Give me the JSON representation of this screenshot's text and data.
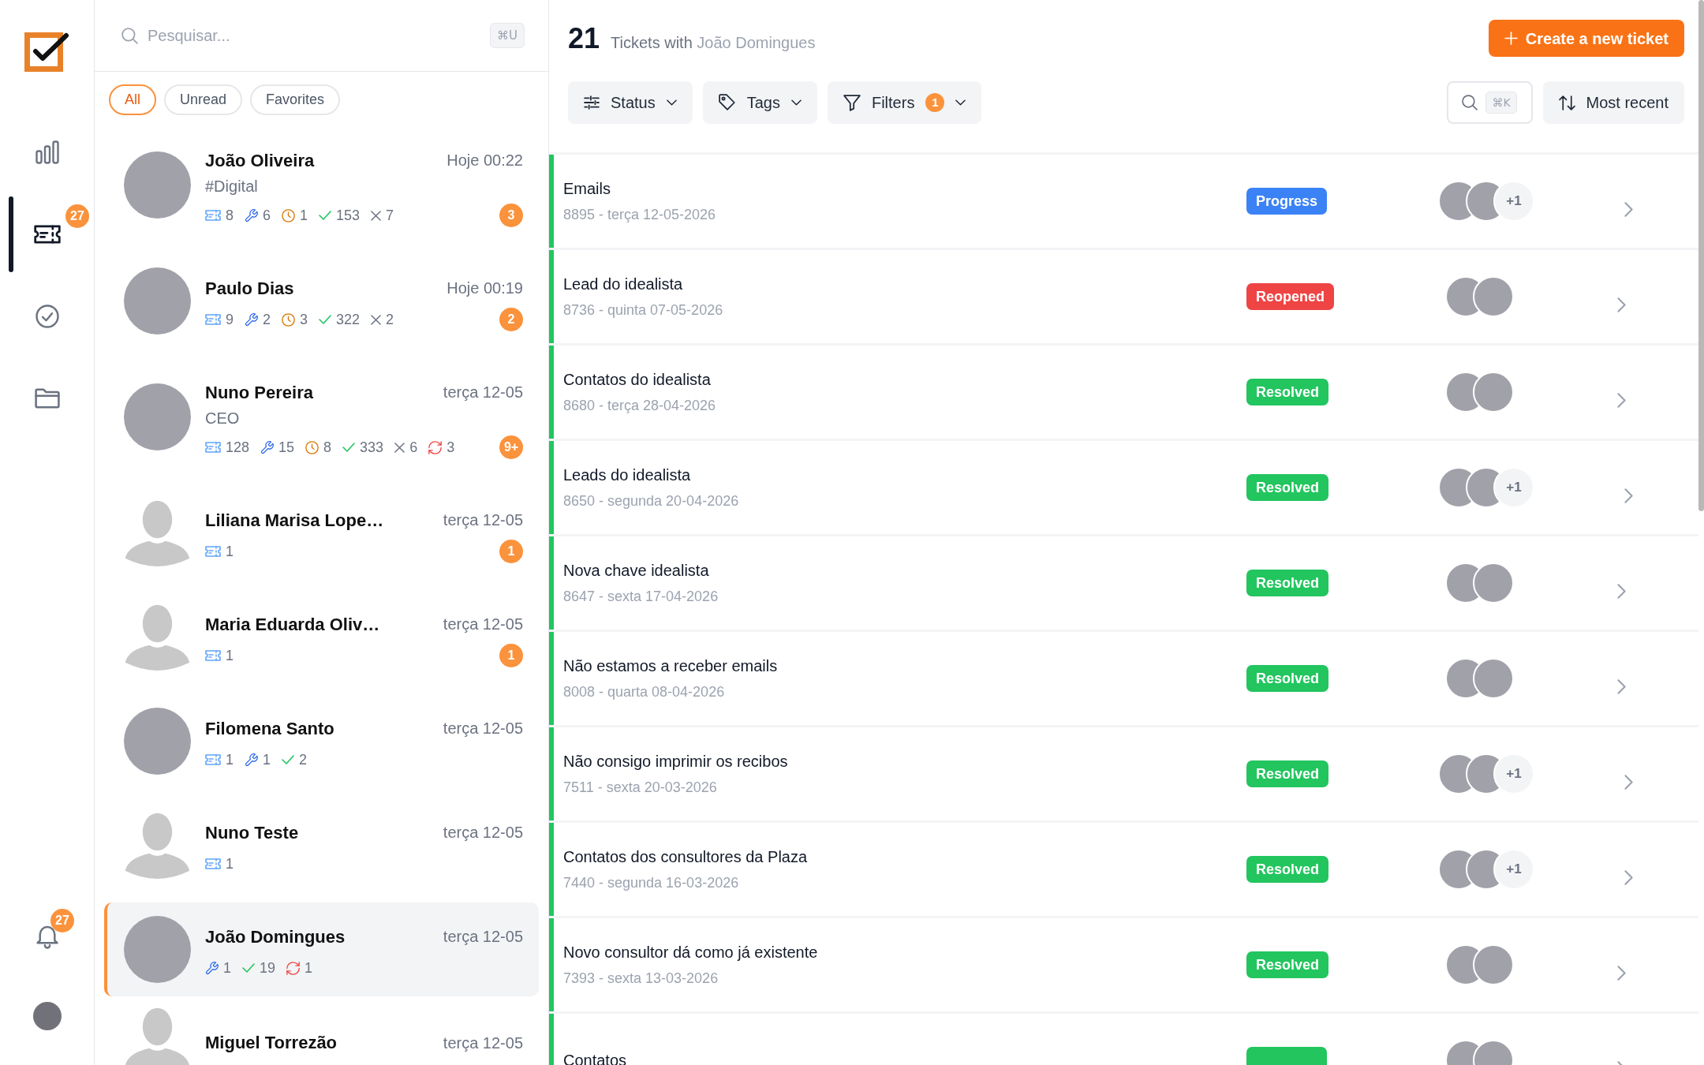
{
  "nav": {
    "items": [
      {
        "selected": false
      },
      {
        "selected": true,
        "badge": "27"
      },
      {
        "selected": false
      },
      {
        "selected": false
      }
    ],
    "notifications": {
      "badge": "27"
    }
  },
  "contacts": {
    "search": {
      "placeholder": "Pesquisar...",
      "shortcut": "⌘U"
    },
    "filters": [
      {
        "label": "All",
        "selected": true
      },
      {
        "label": "Unread",
        "selected": false
      },
      {
        "label": "Favorites",
        "selected": false
      }
    ],
    "items": [
      {
        "name": "João Oliveira",
        "time": "Hoje 00:22",
        "subtitle": "#Digital",
        "photo": true,
        "stats": [
          {
            "kind": "open",
            "value": "8"
          },
          {
            "kind": "progress",
            "value": "6"
          },
          {
            "kind": "pending",
            "value": "1"
          },
          {
            "kind": "resolved",
            "value": "153"
          },
          {
            "kind": "closed",
            "value": "7"
          }
        ],
        "unread": "3",
        "selected": false
      },
      {
        "name": "Paulo Dias",
        "time": "Hoje 00:19",
        "photo": true,
        "stats": [
          {
            "kind": "open",
            "value": "9"
          },
          {
            "kind": "progress",
            "value": "2"
          },
          {
            "kind": "pending",
            "value": "3"
          },
          {
            "kind": "resolved",
            "value": "322"
          },
          {
            "kind": "closed",
            "value": "2"
          }
        ],
        "unread": "2",
        "selected": false
      },
      {
        "name": "Nuno Pereira",
        "time": "terça 12-05",
        "subtitle": "CEO",
        "photo": true,
        "stats": [
          {
            "kind": "open",
            "value": "128"
          },
          {
            "kind": "progress",
            "value": "15"
          },
          {
            "kind": "pending",
            "value": "8"
          },
          {
            "kind": "resolved",
            "value": "333"
          },
          {
            "kind": "closed",
            "value": "6"
          },
          {
            "kind": "reopened",
            "value": "3"
          }
        ],
        "unread": "9+",
        "selected": false
      },
      {
        "name": "Liliana Marisa Lope…",
        "time": "terça 12-05",
        "photo": false,
        "stats": [
          {
            "kind": "open",
            "value": "1"
          }
        ],
        "unread": "1",
        "selected": false
      },
      {
        "name": "Maria Eduarda Oliv…",
        "time": "terça 12-05",
        "photo": false,
        "stats": [
          {
            "kind": "open",
            "value": "1"
          }
        ],
        "unread": "1",
        "selected": false
      },
      {
        "name": "Filomena Santo",
        "time": "terça 12-05",
        "photo": true,
        "stats": [
          {
            "kind": "open",
            "value": "1"
          },
          {
            "kind": "progress",
            "value": "1"
          },
          {
            "kind": "resolved",
            "value": "2"
          }
        ],
        "selected": false
      },
      {
        "name": "Nuno Teste",
        "time": "terça 12-05",
        "photo": false,
        "stats": [
          {
            "kind": "open",
            "value": "1"
          }
        ],
        "selected": false
      },
      {
        "name": "João Domingues",
        "time": "terça 12-05",
        "photo": true,
        "stats": [
          {
            "kind": "progress",
            "value": "1"
          },
          {
            "kind": "resolved",
            "value": "19"
          },
          {
            "kind": "reopened",
            "value": "1"
          }
        ],
        "selected": true
      },
      {
        "name": "Miguel Torrezão",
        "time": "terça 12-05",
        "photo": false,
        "selected": false
      }
    ]
  },
  "main": {
    "header": {
      "count": "21",
      "label": "Tickets with",
      "contact": "João Domingues",
      "create_button": "Create a new ticket"
    },
    "toolbar": {
      "filters": [
        {
          "label": "Status"
        },
        {
          "label": "Tags"
        },
        {
          "label": "Filters",
          "badge": "1"
        }
      ],
      "search_shortcut": "⌘K",
      "sort": "Most recent"
    },
    "tickets": [
      {
        "title": "Emails",
        "subtitle": "8895 - terça 12-05-2026",
        "status": {
          "label": "Progress",
          "color": "#3b82f6"
        },
        "assignees": [
          {
            "photo": true
          },
          {
            "photo": true
          }
        ],
        "extra": "+1"
      },
      {
        "title": "Lead do idealista",
        "subtitle": "8736 - quinta 07-05-2026",
        "status": {
          "label": "Reopened",
          "color": "#ef4444"
        },
        "assignees": [
          {
            "photo": true
          },
          {
            "photo": true
          }
        ]
      },
      {
        "title": "Contatos do idealista",
        "subtitle": "8680 - terça 28-04-2026",
        "status": {
          "label": "Resolved",
          "color": "#22c55e"
        },
        "assignees": [
          {
            "photo": true
          },
          {
            "photo": true
          }
        ]
      },
      {
        "title": "Leads do idealista",
        "subtitle": "8650 - segunda 20-04-2026",
        "status": {
          "label": "Resolved",
          "color": "#22c55e"
        },
        "assignees": [
          {
            "photo": true
          },
          {
            "photo": true
          }
        ],
        "extra": "+1"
      },
      {
        "title": "Nova chave idealista",
        "subtitle": "8647 - sexta 17-04-2026",
        "status": {
          "label": "Resolved",
          "color": "#22c55e"
        },
        "assignees": [
          {
            "photo": true
          },
          {
            "photo": true
          }
        ]
      },
      {
        "title": "Não estamos a receber emails",
        "subtitle": "8008 - quarta 08-04-2026",
        "status": {
          "label": "Resolved",
          "color": "#22c55e"
        },
        "assignees": [
          {
            "photo": true
          },
          {
            "photo": true
          }
        ]
      },
      {
        "title": "Não consigo imprimir os recibos",
        "subtitle": "7511 - sexta 20-03-2026",
        "status": {
          "label": "Resolved",
          "color": "#22c55e"
        },
        "assignees": [
          {
            "photo": true
          },
          {
            "photo": true
          }
        ],
        "extra": "+1"
      },
      {
        "title": "Contatos dos consultores da Plaza",
        "subtitle": "7440 - segunda 16-03-2026",
        "status": {
          "label": "Resolved",
          "color": "#22c55e"
        },
        "assignees": [
          {
            "photo": true
          },
          {
            "photo": true
          }
        ],
        "extra": "+1"
      },
      {
        "title": "Novo consultor dá como já existente",
        "subtitle": "7393 - sexta 13-03-2026",
        "status": {
          "label": "Resolved",
          "color": "#22c55e"
        },
        "assignees": [
          {
            "photo": true
          },
          {
            "photo": true
          }
        ]
      },
      {
        "title": "Contatos",
        "status": {
          "color": "#22c55e"
        },
        "assignees": [
          {
            "photo": true
          },
          {
            "photo": true
          }
        ]
      }
    ]
  }
}
